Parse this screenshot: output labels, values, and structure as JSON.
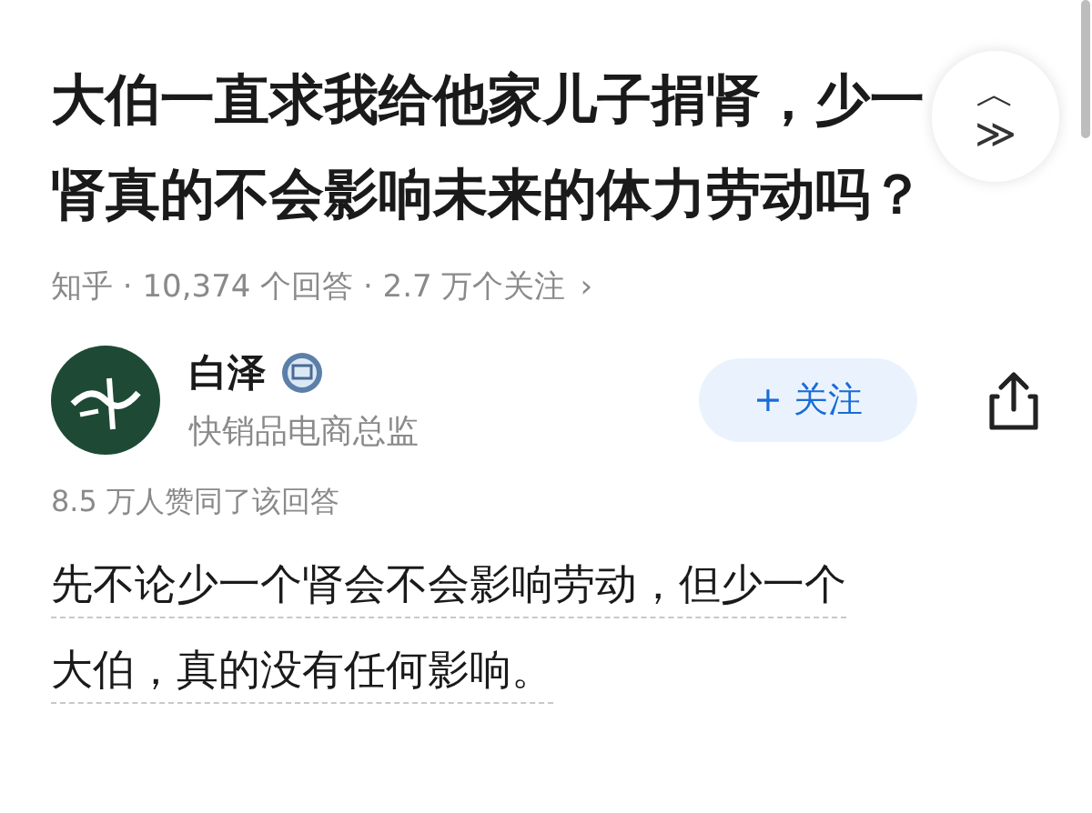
{
  "question": {
    "title_lines": [
      "大伯一直求我给他家儿子捐肾，少一",
      "肾真的不会影响未来的体力劳动吗？"
    ],
    "meta": "知乎 · 10,374 个回答 · 2.7 万个关注",
    "meta_arrow": "›"
  },
  "scroll_button": {
    "up": "︿",
    "down": "≫"
  },
  "author": {
    "name": "白泽",
    "verified": true,
    "bio": "快销品电商总监",
    "follow_button": "+ 关注"
  },
  "answer": {
    "upvotes": "8.5 万人赞同了该回答",
    "lines": [
      "先不论少一个肾会不会影响劳动，但少一个",
      "大伯，真的没有任何影响。"
    ]
  }
}
